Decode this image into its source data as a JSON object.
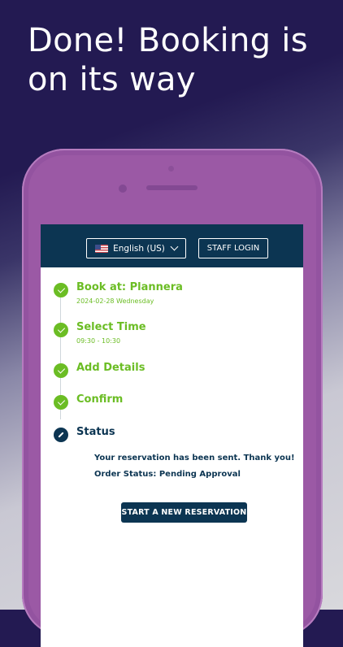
{
  "promo": {
    "headline": "Done! Booking is on its way"
  },
  "topbar": {
    "language_label": "English (US)",
    "staff_login_label": "STAFF LOGIN"
  },
  "steps": [
    {
      "title": "Book at: Plannera",
      "subtitle": "2024-02-28 Wednesday",
      "state": "complete"
    },
    {
      "title": "Select Time",
      "subtitle": "09:30 - 10:30",
      "state": "complete"
    },
    {
      "title": "Add Details",
      "state": "complete"
    },
    {
      "title": "Confirm",
      "state": "complete"
    },
    {
      "title": "Status",
      "state": "current"
    }
  ],
  "status": {
    "message": "Your reservation has been sent. Thank you!",
    "order_status": "Order Status: Pending Approval"
  },
  "actions": {
    "new_reservation_label": "START A NEW RESERVATION"
  },
  "colors": {
    "accent_green": "#6bbd24",
    "navy": "#0c3552",
    "phone_purple": "#9b59a5",
    "bg_dark": "#231a52"
  }
}
